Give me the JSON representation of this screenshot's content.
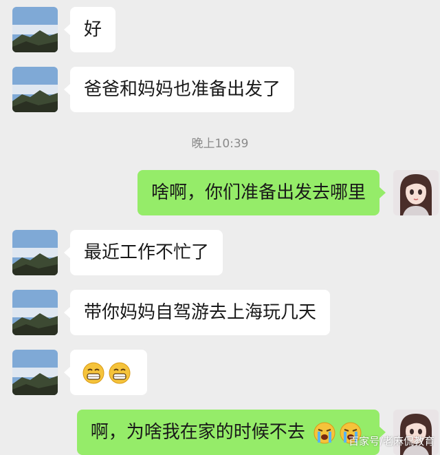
{
  "messages": [
    {
      "side": "left",
      "text": "好"
    },
    {
      "side": "left",
      "text": "爸爸和妈妈也准备出发了"
    },
    {
      "timestamp": "晚上10:39"
    },
    {
      "side": "right",
      "text": "啥啊，你们准备出发去哪里"
    },
    {
      "side": "left",
      "text": "最近工作不忙了"
    },
    {
      "side": "left",
      "text": "带你妈妈自驾游去上海玩几天"
    },
    {
      "side": "left",
      "emojis": [
        "grin-emoji",
        "grin-emoji"
      ]
    },
    {
      "side": "right",
      "text": "啊，为啥我在家的时候不去",
      "emojis": [
        "cry-emoji",
        "cry-emoji"
      ]
    }
  ],
  "watermark": "百家号/老麻侃教育",
  "colors": {
    "background": "#ededed",
    "left_bubble": "#ffffff",
    "right_bubble": "#95ec69",
    "timestamp": "#8a8a8a"
  }
}
